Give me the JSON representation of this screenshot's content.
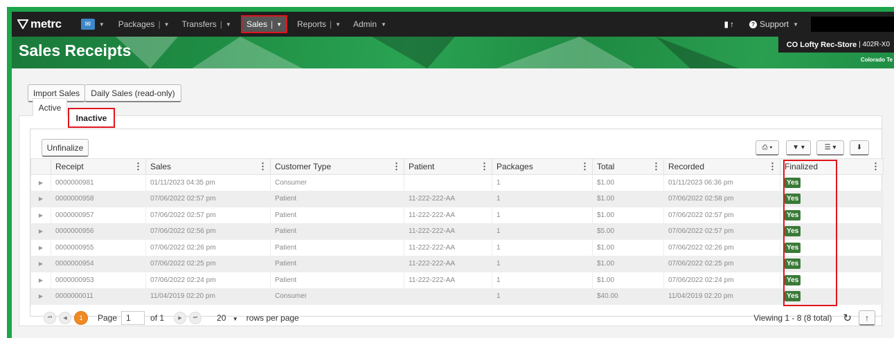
{
  "navbar": {
    "logo_text": "metrc",
    "items": [
      {
        "label": "Packages",
        "sep": "|"
      },
      {
        "label": "Transfers",
        "sep": "|"
      },
      {
        "label": "Sales",
        "sep": "|"
      },
      {
        "label": "Reports",
        "sep": "|"
      },
      {
        "label": "Admin"
      }
    ],
    "support_label": "Support"
  },
  "header": {
    "title": "Sales Receipts",
    "facility_name": "CO Lofty Rec-Store",
    "facility_license": "| 402R-X0",
    "region": "Colorado Te"
  },
  "actions": {
    "import_label": "Import Sales",
    "daily_label": "Daily Sales (read-only)"
  },
  "tabs": {
    "active_label": "Active",
    "inactive_label": "Inactive"
  },
  "grid": {
    "unfinalize_label": "Unfinalize",
    "columns": [
      "Receipt",
      "Sales",
      "Customer Type",
      "Patient",
      "Packages",
      "Total",
      "Recorded",
      "Finalized"
    ],
    "rows": [
      {
        "receipt": "0000000981",
        "sales": "01/11/2023 04:35 pm",
        "customer_type": "Consumer",
        "patient": "",
        "packages": "1",
        "total": "$1.00",
        "recorded": "01/11/2023 06:36 pm",
        "finalized": "Yes"
      },
      {
        "receipt": "0000000958",
        "sales": "07/06/2022 02:57 pm",
        "customer_type": "Patient",
        "patient": "11-222-222-AA",
        "packages": "1",
        "total": "$1.00",
        "recorded": "07/06/2022 02:58 pm",
        "finalized": "Yes"
      },
      {
        "receipt": "0000000957",
        "sales": "07/06/2022 02:57 pm",
        "customer_type": "Patient",
        "patient": "11-222-222-AA",
        "packages": "1",
        "total": "$1.00",
        "recorded": "07/06/2022 02:57 pm",
        "finalized": "Yes"
      },
      {
        "receipt": "0000000956",
        "sales": "07/06/2022 02:56 pm",
        "customer_type": "Patient",
        "patient": "11-222-222-AA",
        "packages": "1",
        "total": "$5.00",
        "recorded": "07/06/2022 02:57 pm",
        "finalized": "Yes"
      },
      {
        "receipt": "0000000955",
        "sales": "07/06/2022 02:26 pm",
        "customer_type": "Patient",
        "patient": "11-222-222-AA",
        "packages": "1",
        "total": "$1.00",
        "recorded": "07/06/2022 02:26 pm",
        "finalized": "Yes"
      },
      {
        "receipt": "0000000954",
        "sales": "07/06/2022 02:25 pm",
        "customer_type": "Patient",
        "patient": "11-222-222-AA",
        "packages": "1",
        "total": "$1.00",
        "recorded": "07/06/2022 02:25 pm",
        "finalized": "Yes"
      },
      {
        "receipt": "0000000953",
        "sales": "07/06/2022 02:24 pm",
        "customer_type": "Patient",
        "patient": "11-222-222-AA",
        "packages": "1",
        "total": "$1.00",
        "recorded": "07/06/2022 02:24 pm",
        "finalized": "Yes"
      },
      {
        "receipt": "0000000011",
        "sales": "11/04/2019 02:20 pm",
        "customer_type": "Consumer",
        "patient": "",
        "packages": "1",
        "total": "$40.00",
        "recorded": "11/04/2019 02:20 pm",
        "finalized": "Yes"
      }
    ]
  },
  "pager": {
    "current_page": "1",
    "page_label": "Page",
    "page_value": "1",
    "of_label": "of 1",
    "rows_per_page_value": "20",
    "rows_per_page_label": "rows per page",
    "viewing": "Viewing 1 - 8 (8 total)"
  },
  "colors": {
    "brand_green": "#1ea44a",
    "highlight_red": "#e0141d",
    "yes_badge": "#3a7a38",
    "pager_current": "#f08a24"
  },
  "icons": [
    "logo-icon",
    "mail-icon",
    "file-icon",
    "upload-icon",
    "help-icon",
    "print-icon",
    "filter-icon",
    "columns-icon",
    "download-icon",
    "refresh-icon",
    "scroll-top-icon"
  ]
}
